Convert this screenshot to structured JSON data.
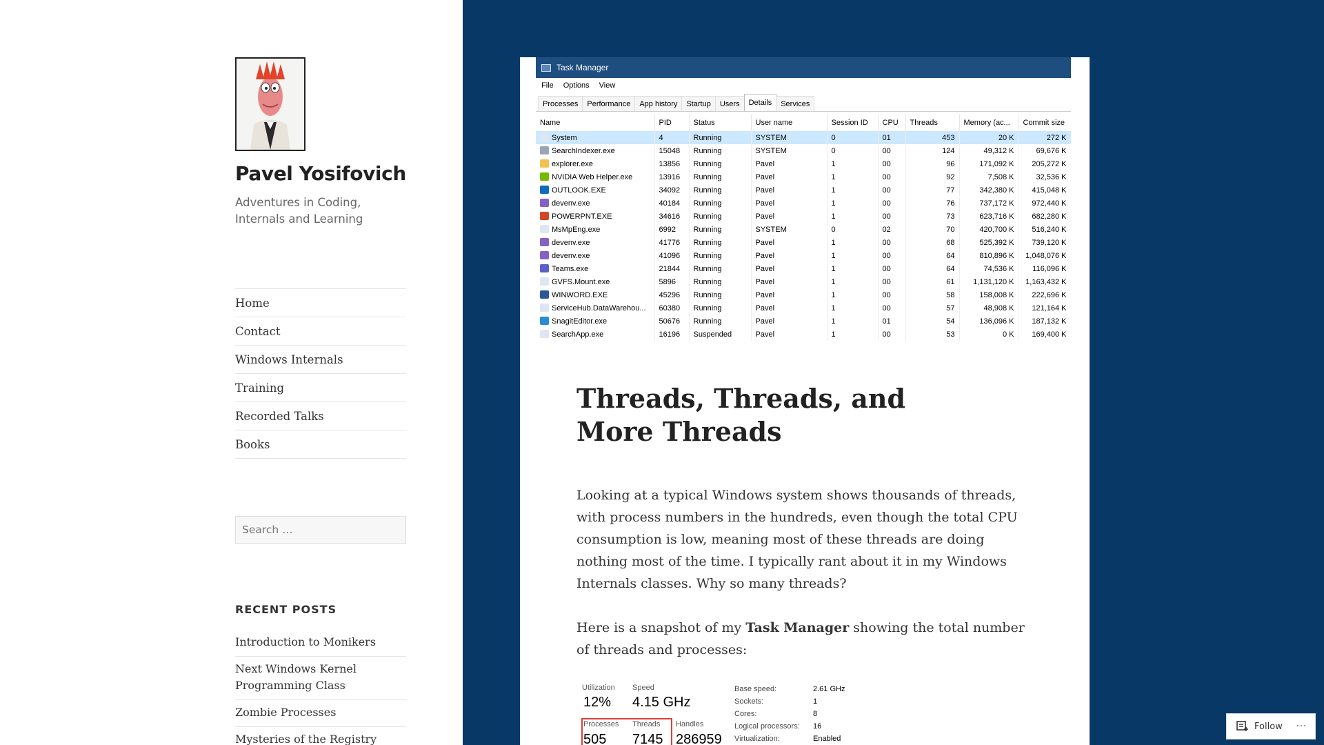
{
  "site": {
    "title": "Pavel Yosifovich",
    "description": "Adventures in Coding, Internals and Learning"
  },
  "nav": [
    "Home",
    "Contact",
    "Windows Internals",
    "Training",
    "Recorded Talks",
    "Books"
  ],
  "search": {
    "placeholder": "Search …"
  },
  "recent_posts": {
    "title": "RECENT POSTS",
    "items": [
      "Introduction to Monikers",
      "Next Windows Kernel Programming Class",
      "Zombie Processes",
      "Mysteries of the Registry"
    ]
  },
  "task_manager": {
    "title": "Task Manager",
    "menu": [
      "File",
      "Options",
      "View"
    ],
    "tabs": [
      "Processes",
      "Performance",
      "App history",
      "Startup",
      "Users",
      "Details",
      "Services"
    ],
    "active_tab": "Details",
    "columns": [
      "Name",
      "PID",
      "Status",
      "User name",
      "Session ID",
      "CPU",
      "Threads",
      "Memory (ac...",
      "Commit size"
    ],
    "rows": [
      {
        "name": "System",
        "pid": "4",
        "status": "Running",
        "user": "SYSTEM",
        "session": "0",
        "cpu": "01",
        "threads": "453",
        "memory": "20 K",
        "commit": "272 K",
        "color": "#dde6f2"
      },
      {
        "name": "SearchIndexer.exe",
        "pid": "15048",
        "status": "Running",
        "user": "SYSTEM",
        "session": "0",
        "cpu": "00",
        "threads": "124",
        "memory": "49,312 K",
        "commit": "69,676 K",
        "color": "#9aa6b4"
      },
      {
        "name": "explorer.exe",
        "pid": "13856",
        "status": "Running",
        "user": "Pavel",
        "session": "1",
        "cpu": "00",
        "threads": "96",
        "memory": "171,092 K",
        "commit": "205,272 K",
        "color": "#f2c14e"
      },
      {
        "name": "NVIDIA Web Helper.exe",
        "pid": "13916",
        "status": "Running",
        "user": "Pavel",
        "session": "1",
        "cpu": "00",
        "threads": "92",
        "memory": "7,508 K",
        "commit": "32,536 K",
        "color": "#76b900"
      },
      {
        "name": "OUTLOOK.EXE",
        "pid": "34092",
        "status": "Running",
        "user": "Pavel",
        "session": "1",
        "cpu": "00",
        "threads": "77",
        "memory": "342,380 K",
        "commit": "415,048 K",
        "color": "#0f6cbd"
      },
      {
        "name": "devenv.exe",
        "pid": "40184",
        "status": "Running",
        "user": "Pavel",
        "session": "1",
        "cpu": "00",
        "threads": "76",
        "memory": "737,172 K",
        "commit": "972,440 K",
        "color": "#8661c5"
      },
      {
        "name": "POWERPNT.EXE",
        "pid": "34616",
        "status": "Running",
        "user": "Pavel",
        "session": "1",
        "cpu": "00",
        "threads": "73",
        "memory": "623,716 K",
        "commit": "682,280 K",
        "color": "#d24726"
      },
      {
        "name": "MsMpEng.exe",
        "pid": "6992",
        "status": "Running",
        "user": "SYSTEM",
        "session": "0",
        "cpu": "02",
        "threads": "70",
        "memory": "420,700 K",
        "commit": "516,240 K",
        "color": "#dde6f2"
      },
      {
        "name": "devenv.exe",
        "pid": "41776",
        "status": "Running",
        "user": "Pavel",
        "session": "1",
        "cpu": "00",
        "threads": "68",
        "memory": "525,392 K",
        "commit": "739,120 K",
        "color": "#8661c5"
      },
      {
        "name": "devenv.exe",
        "pid": "41096",
        "status": "Running",
        "user": "Pavel",
        "session": "1",
        "cpu": "00",
        "threads": "64",
        "memory": "810,896 K",
        "commit": "1,048,076 K",
        "color": "#8661c5"
      },
      {
        "name": "Teams.exe",
        "pid": "21844",
        "status": "Running",
        "user": "Pavel",
        "session": "1",
        "cpu": "00",
        "threads": "64",
        "memory": "74,536 K",
        "commit": "116,096 K",
        "color": "#5b5fc7"
      },
      {
        "name": "GVFS.Mount.exe",
        "pid": "5896",
        "status": "Running",
        "user": "Pavel",
        "session": "1",
        "cpu": "00",
        "threads": "61",
        "memory": "1,131,120 K",
        "commit": "1,163,432 K",
        "color": "#dde6f2"
      },
      {
        "name": "WINWORD.EXE",
        "pid": "45296",
        "status": "Running",
        "user": "Pavel",
        "session": "1",
        "cpu": "00",
        "threads": "58",
        "memory": "158,008 K",
        "commit": "222,696 K",
        "color": "#2b579a"
      },
      {
        "name": "ServiceHub.DataWarehou...",
        "pid": "60380",
        "status": "Running",
        "user": "Pavel",
        "session": "1",
        "cpu": "00",
        "threads": "57",
        "memory": "48,908 K",
        "commit": "121,164 K",
        "color": "#dde6f2"
      },
      {
        "name": "SnagitEditor.exe",
        "pid": "50676",
        "status": "Running",
        "user": "Pavel",
        "session": "1",
        "cpu": "01",
        "threads": "54",
        "memory": "136,096 K",
        "commit": "187,132 K",
        "color": "#2a8bd6"
      },
      {
        "name": "SearchApp.exe",
        "pid": "16196",
        "status": "Suspended",
        "user": "Pavel",
        "session": "1",
        "cpu": "00",
        "threads": "53",
        "memory": "0 K",
        "commit": "169,400 K",
        "color": "#dde6f2"
      }
    ]
  },
  "post": {
    "title": "Threads, Threads, and More Threads",
    "para1": "Looking at a typical Windows system shows thousands of threads, with process numbers in the hundreds, even though the total CPU consumption is low, meaning most of these threads are doing nothing most of the time. I typically rant about it in my Windows Internals classes. Why so many threads?",
    "para2_before": "Here is a snapshot of my ",
    "para2_bold": "Task Manager",
    "para2_after": " showing the total number of threads and processes:"
  },
  "perf": {
    "utilization_label": "Utilization",
    "utilization": "12%",
    "speed_label": "Speed",
    "speed": "4.15 GHz",
    "processes_label": "Processes",
    "processes": "505",
    "threads_label": "Threads",
    "threads": "7145",
    "handles_label": "Handles",
    "handles": "286959",
    "details": [
      {
        "k": "Base speed:",
        "v": "2.61 GHz"
      },
      {
        "k": "Sockets:",
        "v": "1"
      },
      {
        "k": "Cores:",
        "v": "8"
      },
      {
        "k": "Logical processors:",
        "v": "16"
      },
      {
        "k": "Virtualization:",
        "v": "Enabled"
      }
    ]
  },
  "follow": {
    "label": "Follow",
    "more": "···"
  }
}
